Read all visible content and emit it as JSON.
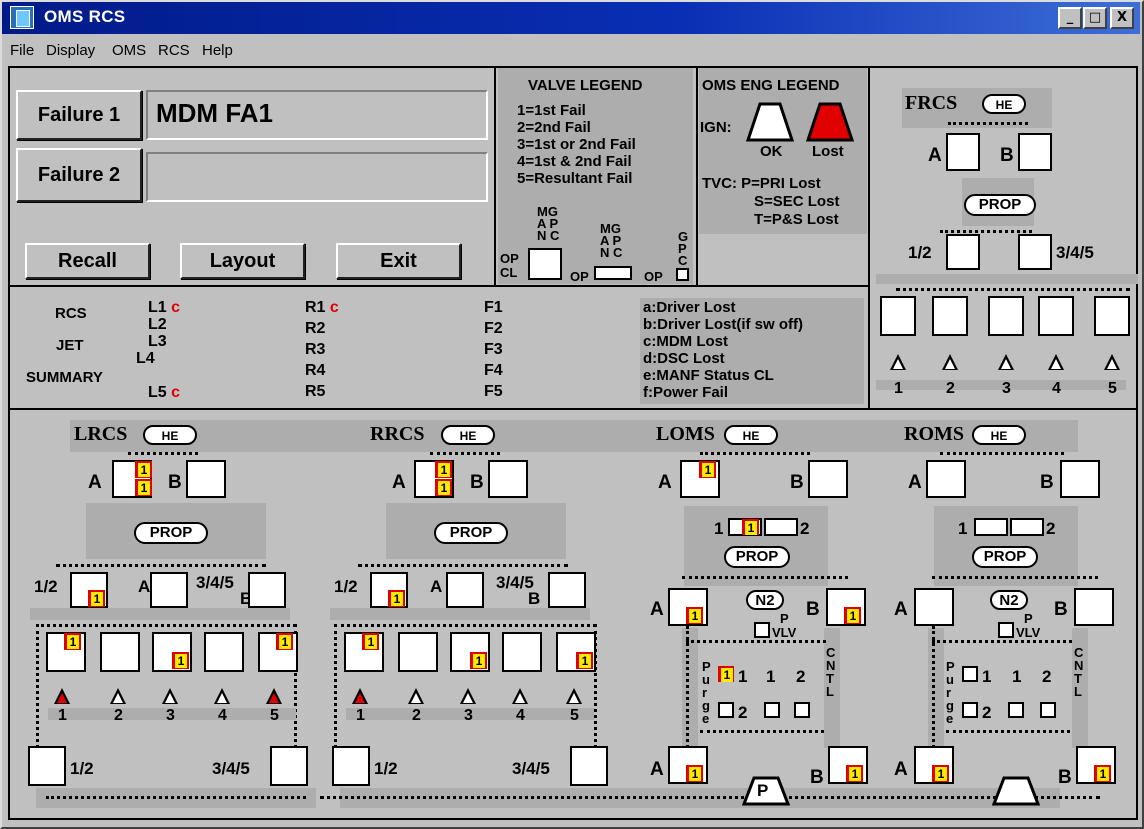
{
  "window": {
    "title": "OMS RCS",
    "min": "_",
    "max": "□",
    "close": "X"
  },
  "menu": [
    "File",
    "Display",
    "OMS",
    "RCS",
    "Help"
  ],
  "controls": {
    "failure1_label": "Failure 1",
    "failure1_value": "MDM FA1",
    "failure2_label": "Failure 2",
    "failure2_value": "",
    "recall": "Recall",
    "layout": "Layout",
    "exit": "Exit"
  },
  "valve_legend": {
    "title": "VALVE LEGEND",
    "items": [
      "1=1st Fail",
      "2=2nd Fail",
      "3=1st or 2nd Fail",
      "4=1st & 2nd Fail",
      "5=Resultant Fail"
    ],
    "col1": [
      "MG",
      "A P",
      "N C"
    ],
    "col2": [
      "MG",
      "A P",
      "N C"
    ],
    "col3": [
      "G",
      "P",
      "C"
    ],
    "op": "OP",
    "cl": "CL"
  },
  "oms_legend": {
    "title": "OMS ENG LEGEND",
    "ign": "IGN:",
    "ok": "OK",
    "lost": "Lost",
    "tvc": [
      "TVC: P=PRI Lost",
      "S=SEC Lost",
      "T=P&S Lost"
    ]
  },
  "jet_summary": {
    "labels": [
      "RCS",
      "JET",
      "SUMMARY"
    ],
    "left": [
      "L1",
      "L2",
      "L3",
      "L4",
      "L5"
    ],
    "left_flags": [
      "c",
      "",
      "",
      "",
      "c"
    ],
    "right": [
      "R1",
      "R2",
      "R3",
      "R4",
      "R5"
    ],
    "right_flags": [
      "c",
      "",
      "",
      "",
      ""
    ],
    "fwd": [
      "F1",
      "F2",
      "F3",
      "F4",
      "F5"
    ],
    "codes": [
      "a:Driver Lost",
      "b:Driver Lost(if sw off)",
      "c:MDM Lost",
      "d:DSC Lost",
      "e:MANF Status CL",
      "f:Power Fail"
    ]
  },
  "frcs": {
    "title": "FRCS",
    "he": "HE",
    "a": "A",
    "b": "B",
    "prop": "PROP",
    "m12": "1/2",
    "m345": "3/4/5",
    "jets": [
      "1",
      "2",
      "3",
      "4",
      "5"
    ]
  },
  "lrcs": {
    "title": "LRCS",
    "he": "HE",
    "a": "A",
    "b": "B",
    "prop": "PROP",
    "m12": "1/2",
    "mid": "A",
    "m345": "3/4/5",
    "m345b": "B",
    "jets": [
      "1",
      "2",
      "3",
      "4",
      "5"
    ],
    "xf12": "1/2",
    "xf345": "3/4/5"
  },
  "rrcs": {
    "title": "RRCS",
    "he": "HE",
    "a": "A",
    "b": "B",
    "prop": "PROP",
    "m12": "1/2",
    "mid": "A",
    "m345": "3/4/5",
    "m345b": "B",
    "jets": [
      "1",
      "2",
      "3",
      "4",
      "5"
    ],
    "xf12": "1/2",
    "xf345": "3/4/5"
  },
  "loms": {
    "title": "LOMS",
    "he": "HE",
    "a": "A",
    "b": "B",
    "one": "1",
    "two": "2",
    "prop": "PROP",
    "n2": "N2",
    "pvlv": [
      "P",
      "VLV"
    ],
    "purge": "Purge",
    "cntl": "CNTL",
    "v1": "1",
    "v2": "2",
    "v1b": "1",
    "v2b": "2",
    "eng": "P"
  },
  "roms": {
    "title": "ROMS",
    "he": "HE",
    "a": "A",
    "b": "B",
    "one": "1",
    "two": "2",
    "prop": "PROP",
    "n2": "N2",
    "pvlv": [
      "P",
      "VLV"
    ],
    "purge": "Purge",
    "cntl": "CNTL",
    "v1": "1",
    "v2": "2",
    "v1b": "1",
    "v2b": "2",
    "eng": ""
  }
}
